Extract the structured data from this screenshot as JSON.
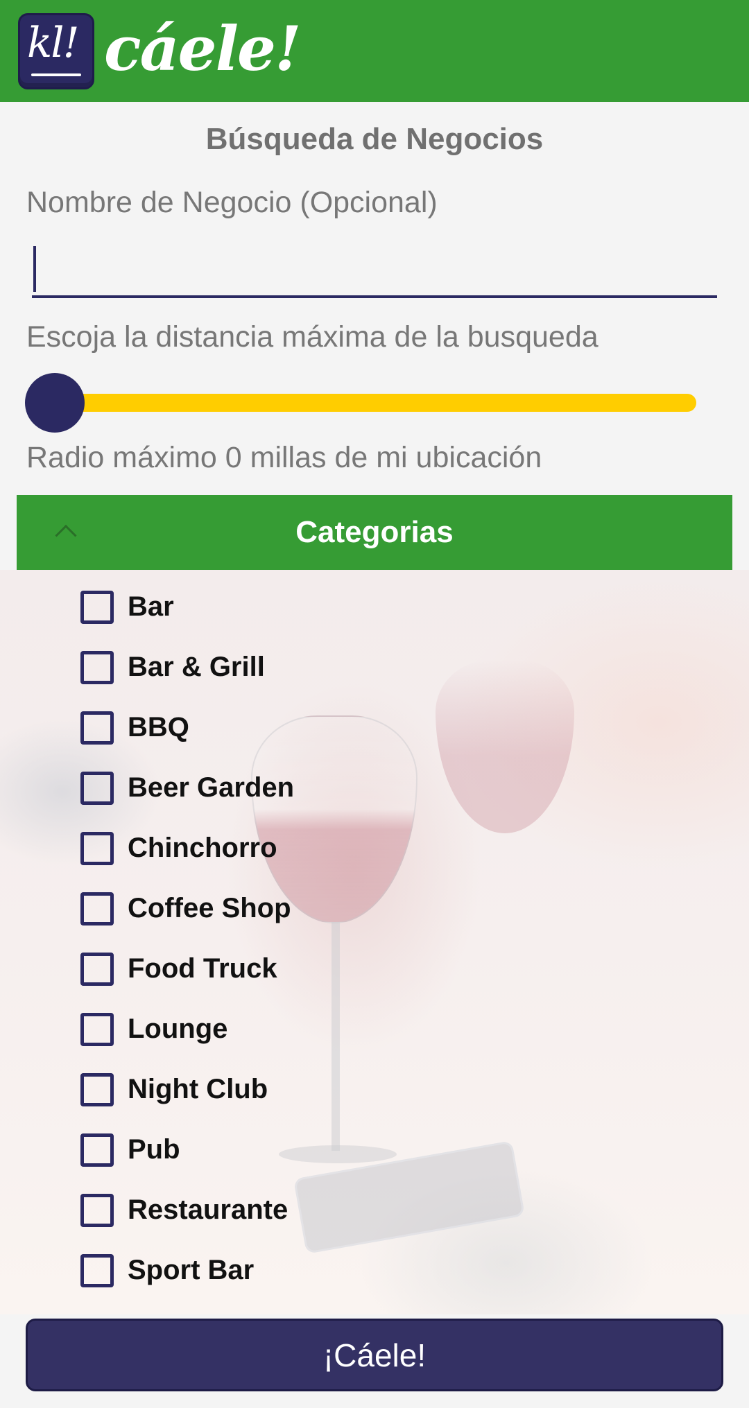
{
  "app": {
    "logo_mark": "kl!",
    "brand_name": "cáele!",
    "brand_color": "#369c34",
    "primary_color": "#2b2962",
    "accent_color": "#ffcd00"
  },
  "form": {
    "title": "Búsqueda de Negocios",
    "name_label": "Nombre de Negocio (Opcional)",
    "name_value": "",
    "distance_label": "Escoja la distancia máxima de la busqueda",
    "slider_value": 0,
    "radius_text": "Radio máximo 0 millas de mi ubicación"
  },
  "categories": {
    "header": "Categorias",
    "expanded": true,
    "items": [
      {
        "label": "Bar",
        "checked": false
      },
      {
        "label": "Bar & Grill",
        "checked": false
      },
      {
        "label": "BBQ",
        "checked": false
      },
      {
        "label": "Beer Garden",
        "checked": false
      },
      {
        "label": "Chinchorro",
        "checked": false
      },
      {
        "label": "Coffee Shop",
        "checked": false
      },
      {
        "label": "Food Truck",
        "checked": false
      },
      {
        "label": "Lounge",
        "checked": false
      },
      {
        "label": "Night Club",
        "checked": false
      },
      {
        "label": "Pub",
        "checked": false
      },
      {
        "label": "Restaurante",
        "checked": false
      },
      {
        "label": "Sport Bar",
        "checked": false
      }
    ]
  },
  "action": {
    "submit_label": "¡Cáele!"
  }
}
